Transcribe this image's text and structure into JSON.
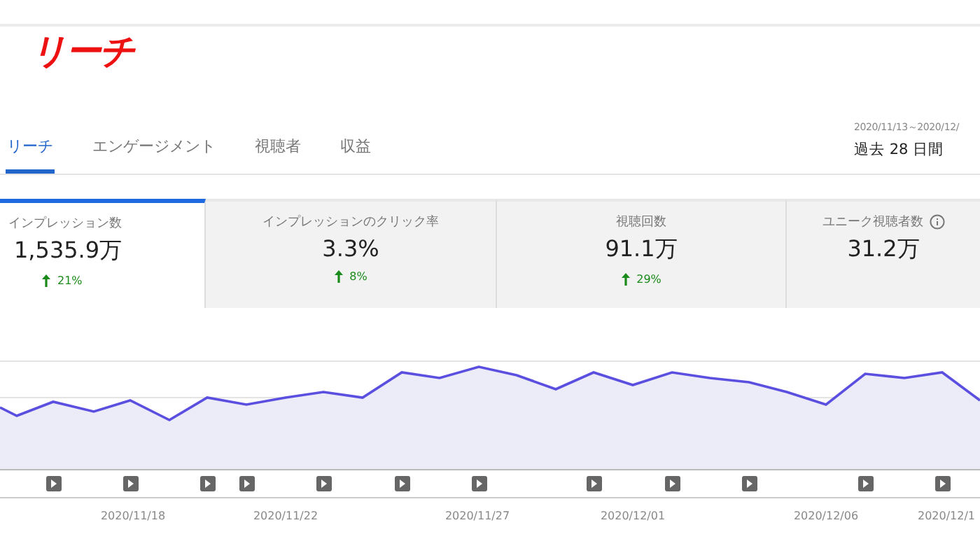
{
  "title": "リーチ",
  "tabs": [
    {
      "label": "リーチ",
      "selected": true
    },
    {
      "label": "エンゲージメント",
      "selected": false
    },
    {
      "label": "視聴者",
      "selected": false
    },
    {
      "label": "収益",
      "selected": false
    }
  ],
  "date_range": {
    "range": "2020/11/13～2020/12/",
    "period": "過去 28 日間"
  },
  "metrics": [
    {
      "label": "インプレッション数",
      "value": "1,535.9万",
      "change": "21%",
      "selected": true
    },
    {
      "label": "インプレッションのクリック率",
      "value": "3.3%",
      "change": "8%",
      "selected": false
    },
    {
      "label": "視聴回数",
      "value": "91.1万",
      "change": "29%",
      "selected": false
    },
    {
      "label": "ユニーク視聴者数",
      "value": "31.2万",
      "selected": false
    }
  ],
  "chart": {
    "x_labels": [
      "2020/11/18",
      "2020/11/22",
      "2020/11/27",
      "2020/12/01",
      "2020/12/06",
      "2020/12/1"
    ]
  }
}
